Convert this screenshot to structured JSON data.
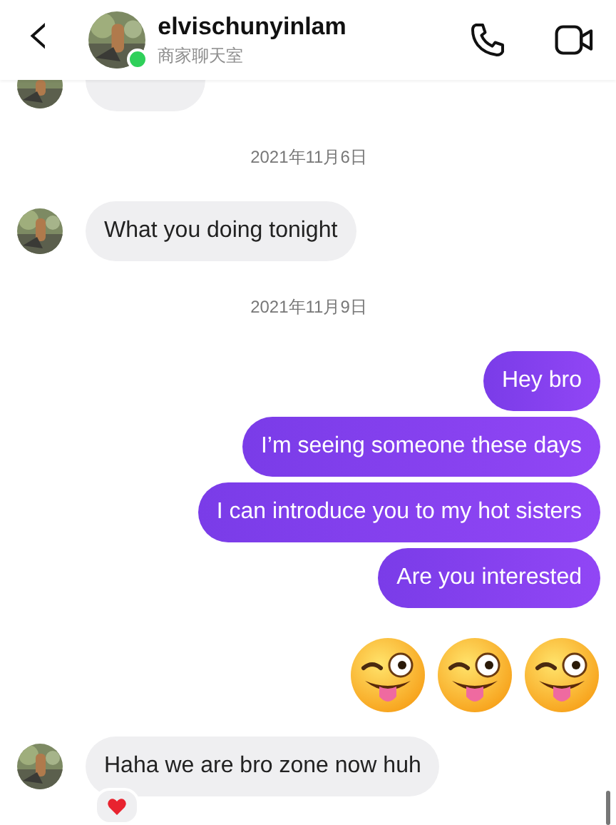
{
  "header": {
    "back": "‹",
    "name": "elvischunyinlam",
    "subtitle": "商家聊天室",
    "online": true
  },
  "messages": [
    {
      "kind": "received_cut"
    },
    {
      "kind": "date",
      "text": "2021年11月6日"
    },
    {
      "kind": "received",
      "text": "What you doing tonight"
    },
    {
      "kind": "date",
      "text": "2021年11月9日"
    },
    {
      "kind": "sent",
      "text": "Hey bro"
    },
    {
      "kind": "sent",
      "text": "I’m seeing someone these days"
    },
    {
      "kind": "sent",
      "text": "I can introduce you to my hot sisters"
    },
    {
      "kind": "sent",
      "text": "Are you interested"
    },
    {
      "kind": "emoji",
      "items": [
        {
          "kind": "winking-tongue"
        },
        {
          "kind": "winking-tongue"
        },
        {
          "kind": "winking-tongue"
        }
      ]
    },
    {
      "kind": "received",
      "text": "Haha we are bro zone now huh",
      "reaction": true
    }
  ]
}
